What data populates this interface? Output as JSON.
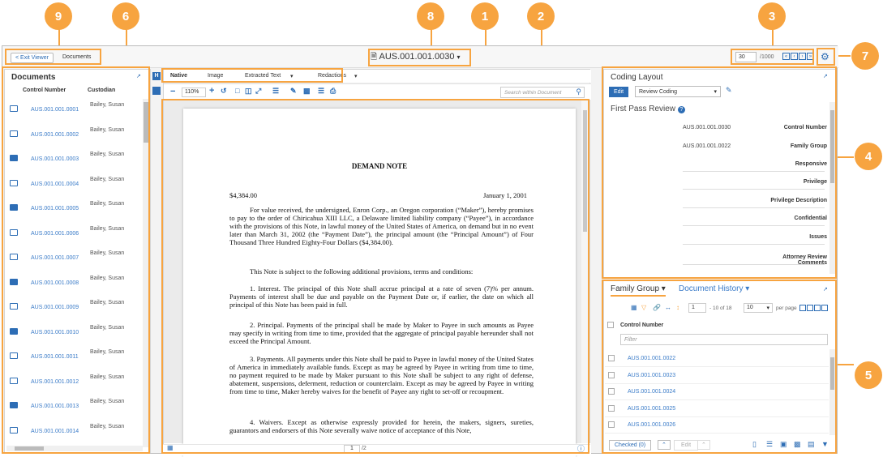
{
  "callouts": {
    "c1": "1",
    "c2": "2",
    "c3": "3",
    "c4": "4",
    "c5": "5",
    "c6": "6",
    "c7": "7",
    "c8": "8",
    "c9": "9"
  },
  "header": {
    "exit_viewer": "< Exit Viewer",
    "documents_tab": "Documents",
    "doc_title": "AUS.001.001.0030",
    "nav_current": "30",
    "nav_total": "/1000"
  },
  "documents_panel": {
    "title": "Documents",
    "col_control": "Control Number",
    "col_custodian": "Custodian",
    "rows": [
      {
        "cn": "AUS.001.001.0001",
        "cu": "Bailey, Susan",
        "icon": "email"
      },
      {
        "cn": "AUS.001.001.0002",
        "cu": "Bailey, Susan",
        "icon": "email"
      },
      {
        "cn": "AUS.001.001.0003",
        "cu": "Bailey, Susan",
        "icon": "word"
      },
      {
        "cn": "AUS.001.001.0004",
        "cu": "Bailey, Susan",
        "icon": "email"
      },
      {
        "cn": "AUS.001.001.0005",
        "cu": "Bailey, Susan",
        "icon": "word"
      },
      {
        "cn": "AUS.001.001.0006",
        "cu": "Bailey, Susan",
        "icon": "email"
      },
      {
        "cn": "AUS.001.001.0007",
        "cu": "Bailey, Susan",
        "icon": "email"
      },
      {
        "cn": "AUS.001.001.0008",
        "cu": "Bailey, Susan",
        "icon": "word"
      },
      {
        "cn": "AUS.001.001.0009",
        "cu": "Bailey, Susan",
        "icon": "email"
      },
      {
        "cn": "AUS.001.001.0010",
        "cu": "Bailey, Susan",
        "icon": "word"
      },
      {
        "cn": "AUS.001.001.0011",
        "cu": "Bailey, Susan",
        "icon": "email"
      },
      {
        "cn": "AUS.001.001.0012",
        "cu": "Bailey, Susan",
        "icon": "email"
      },
      {
        "cn": "AUS.001.001.0013",
        "cu": "Bailey, Susan",
        "icon": "word"
      },
      {
        "cn": "AUS.001.001.0014",
        "cu": "Bailey, Susan",
        "icon": "email"
      }
    ]
  },
  "viewer": {
    "tabs": [
      "Native",
      "Image",
      "Extracted Text",
      "Redactions"
    ],
    "zoom": "110%",
    "search_placeholder": "Search within Document",
    "page_current": "1",
    "page_total": "/2"
  },
  "document": {
    "heading": "DEMAND NOTE",
    "amount": "$4,384.00",
    "date": "January 1, 2001",
    "p1": "For value received, the undersigned, Enron Corp., an Oregon corporation (“Maker”), hereby promises to pay to the order of Chiricahua XIII LLC, a Delaware limited liability company (“Payee”), in accordance with the provisions of this Note, in lawful money of the United States of America, on demand but in no event later than March 31, 2002 (the “Payment Date”), the principal amount (the “Principal Amount”) of Four Thousand Three Hundred Eighty-Four Dollars ($4,384.00).",
    "p2": "This Note is subject to the following additional provisions, terms and conditions:",
    "p3": "1.   Interest. The principal of this Note shall accrue principal at a rate of seven (7)% per annum. Payments of interest shall be due and payable on the Payment Date or, if earlier, the date on which all principal of this Note has been paid in full.",
    "p4": "2.   Principal. Payments of the principal shall be made by Maker to Payee in such amounts as Payee may specify in writing from time to time, provided that the aggregate of principal payable hereunder shall not exceed the Principal Amount.",
    "p5": "3.   Payments. All payments under this Note shall be paid to Payee in lawful money of the United States of America in immediately available funds. Except as may be agreed by Payee in writing from time to time, no payment required to be made by Maker pursuant to this Note shall be subject to any right of defense, abatement, suspensions, deferment, reduction or counterclaim. Except as may be agreed by Payee in writing from time to time, Maker hereby waives for the benefit of Payee any right to set-off or recoupment.",
    "p6": "4.   Waivers. Except as otherwise expressly provided for herein, the makers, signers, sureties, guarantors and endorsers of this Note severally waive notice of acceptance of this Note,"
  },
  "coding": {
    "title": "Coding Layout",
    "edit": "Edit",
    "layout_select": "Review Coding",
    "section": "First Pass Review",
    "fields": [
      {
        "label": "Control Number",
        "value": "AUS.001.001.0030"
      },
      {
        "label": "Family Group",
        "value": "AUS.001.001.0022"
      },
      {
        "label": "Responsive",
        "value": ""
      },
      {
        "label": "Privilege",
        "value": ""
      },
      {
        "label": "Privilege Description",
        "value": ""
      },
      {
        "label": "Confidential",
        "value": ""
      },
      {
        "label": "Issues",
        "value": ""
      },
      {
        "label": "Attorney Review Comments",
        "value": ""
      }
    ]
  },
  "family": {
    "tab1": "Family Group",
    "tab2": "Document History",
    "page_input": "1",
    "of_text": "- 10 of 18",
    "per_page": "10",
    "per_page_label": "per page",
    "col": "Control Number",
    "filter_placeholder": "Filter",
    "rows": [
      "AUS.001.001.0022",
      "AUS.001.001.0023",
      "AUS.001.001.0024",
      "AUS.001.001.0025",
      "AUS.001.001.0026"
    ],
    "checked": "Checked (0)",
    "edit": "Edit"
  }
}
